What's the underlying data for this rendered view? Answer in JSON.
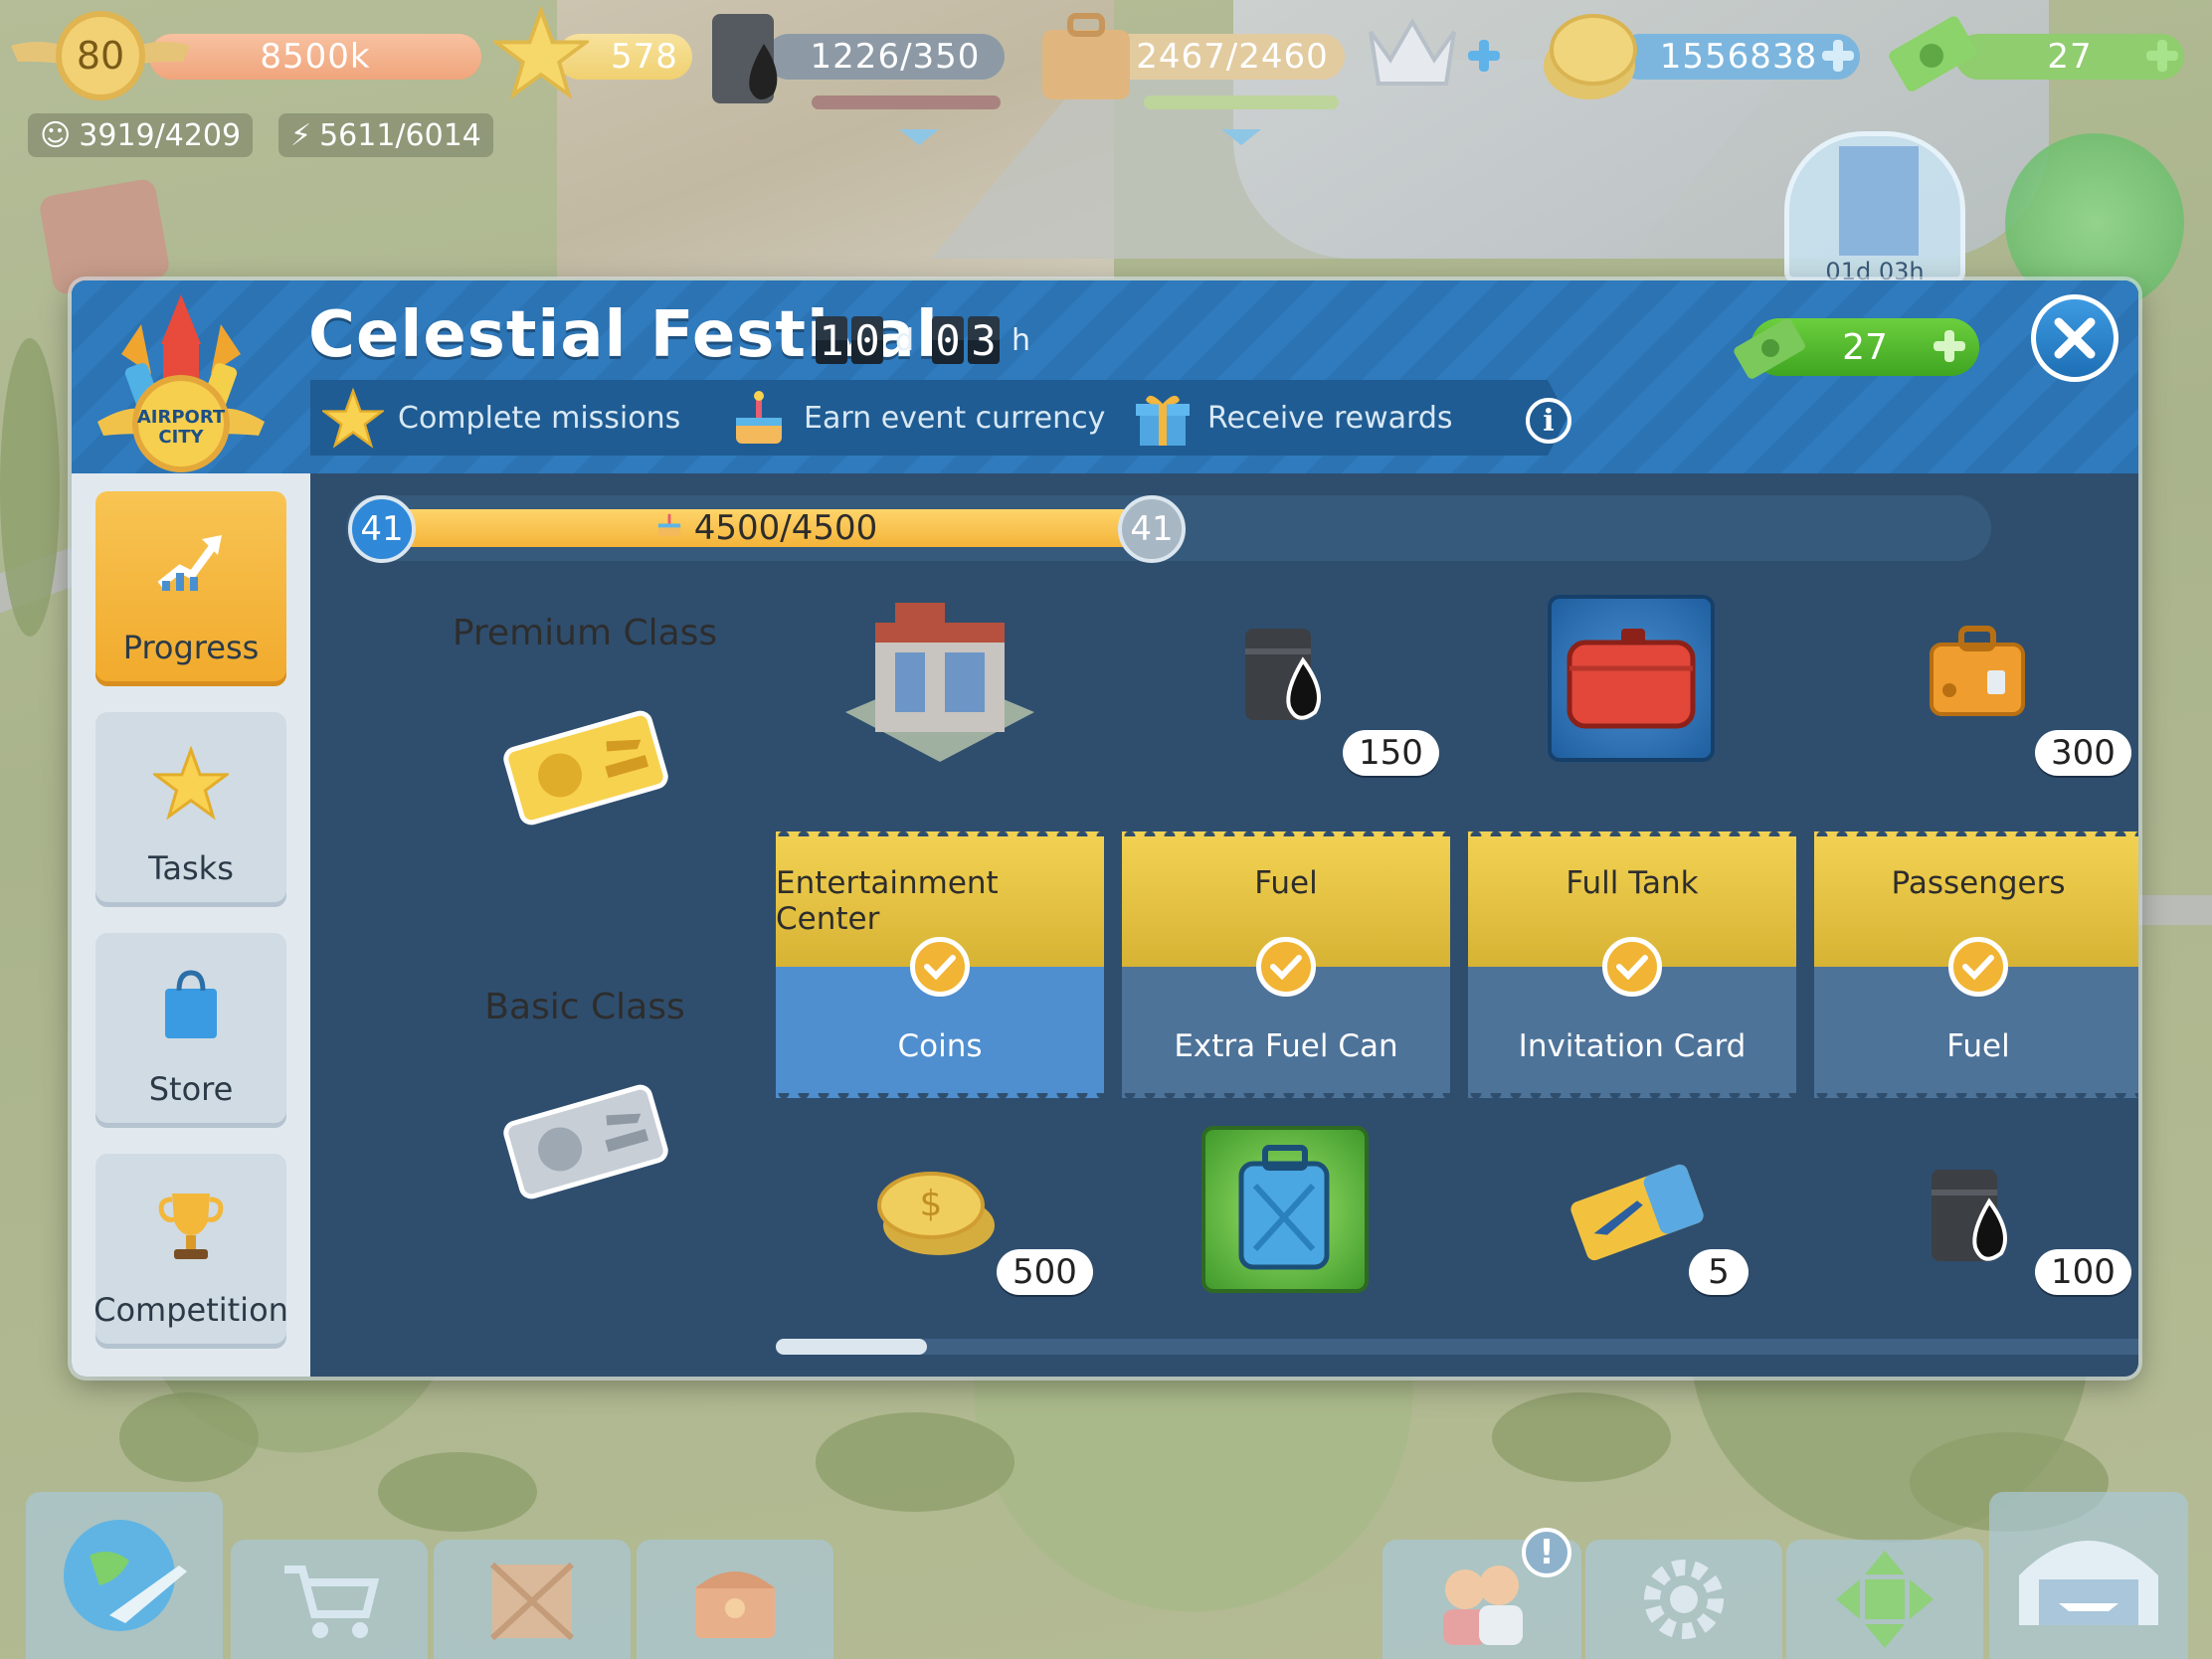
{
  "hud": {
    "level": "80",
    "xp": "8500k",
    "stars": "578",
    "fuel": "1226/350",
    "passengers_cap": "2467/2460",
    "coins": "1556838",
    "cash": "27",
    "population": "3919/4209",
    "power": "5611/6014",
    "building_timer": "01d 03h"
  },
  "modal": {
    "title": "Celestial Festival",
    "timer": {
      "days": [
        "1",
        "0"
      ],
      "days_unit": "d",
      "hours": [
        "0",
        "3"
      ],
      "hours_unit": "h"
    },
    "cash": "27",
    "logo_text": [
      "AIRPORT",
      "CITY"
    ],
    "steps": [
      {
        "label": "Complete missions",
        "icon": "star-icon"
      },
      {
        "label": "Earn event currency",
        "icon": "cake-icon"
      },
      {
        "label": "Receive rewards",
        "icon": "gift-icon"
      }
    ]
  },
  "sidebar": {
    "tabs": [
      {
        "label": "Progress",
        "icon": "progress-arrow-icon",
        "active": true
      },
      {
        "label": "Tasks",
        "icon": "star-icon",
        "active": false
      },
      {
        "label": "Store",
        "icon": "shopping-bag-icon",
        "active": false
      },
      {
        "label": "Competition",
        "icon": "trophy-icon",
        "active": false
      }
    ]
  },
  "progress": {
    "level_left": "41",
    "level_right": "41",
    "text": "4500/4500",
    "fraction": 1.0
  },
  "classes": {
    "premium": {
      "label": "Premium Class"
    },
    "basic": {
      "label": "Basic Class"
    }
  },
  "rewards": [
    {
      "premium": "Entertainment Center",
      "premium_qty": "",
      "basic": "Coins",
      "basic_qty": "500"
    },
    {
      "premium": "Fuel",
      "premium_qty": "150",
      "basic": "Extra Fuel Can",
      "basic_qty": ""
    },
    {
      "premium": "Full Tank",
      "premium_qty": "",
      "basic": "Invitation Card",
      "basic_qty": "5"
    },
    {
      "premium": "Passengers",
      "premium_qty": "300",
      "basic": "Fuel",
      "basic_qty": "100"
    }
  ],
  "colors": {
    "accent_blue": "#2f7bbd",
    "gold": "#f1aa2c",
    "green": "#4cb52b"
  }
}
